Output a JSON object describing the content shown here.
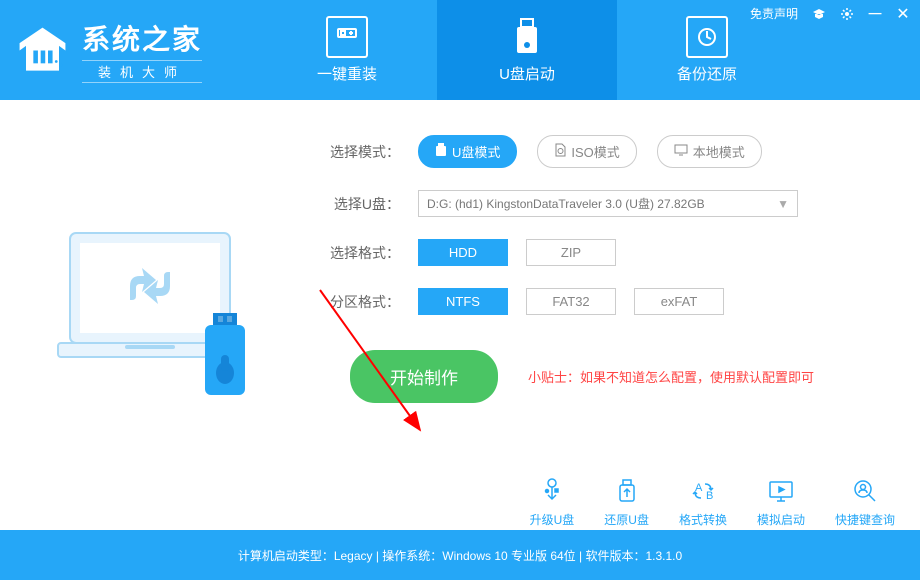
{
  "app": {
    "title": "系统之家",
    "subtitle": "装机大师",
    "disclaimer": "免责声明"
  },
  "tabs": [
    {
      "label": "一键重装"
    },
    {
      "label": "U盘启动"
    },
    {
      "label": "备份还原"
    }
  ],
  "form": {
    "mode_label": "选择模式：",
    "modes": [
      {
        "label": "U盘模式"
      },
      {
        "label": "ISO模式"
      },
      {
        "label": "本地模式"
      }
    ],
    "usb_label": "选择U盘：",
    "usb_value": "D:G: (hd1) KingstonDataTraveler 3.0 (U盘) 27.82GB",
    "format_label": "选择格式：",
    "formats": [
      {
        "label": "HDD"
      },
      {
        "label": "ZIP"
      }
    ],
    "partition_label": "分区格式：",
    "partitions": [
      {
        "label": "NTFS"
      },
      {
        "label": "FAT32"
      },
      {
        "label": "exFAT"
      }
    ],
    "start_button": "开始制作",
    "tip": "小贴士：如果不知道怎么配置，使用默认配置即可"
  },
  "tools": [
    {
      "label": "升级U盘"
    },
    {
      "label": "还原U盘"
    },
    {
      "label": "格式转换"
    },
    {
      "label": "模拟启动"
    },
    {
      "label": "快捷键查询"
    }
  ],
  "statusbar": "计算机启动类型：Legacy | 操作系统：Windows 10 专业版 64位 | 软件版本：1.3.1.0"
}
